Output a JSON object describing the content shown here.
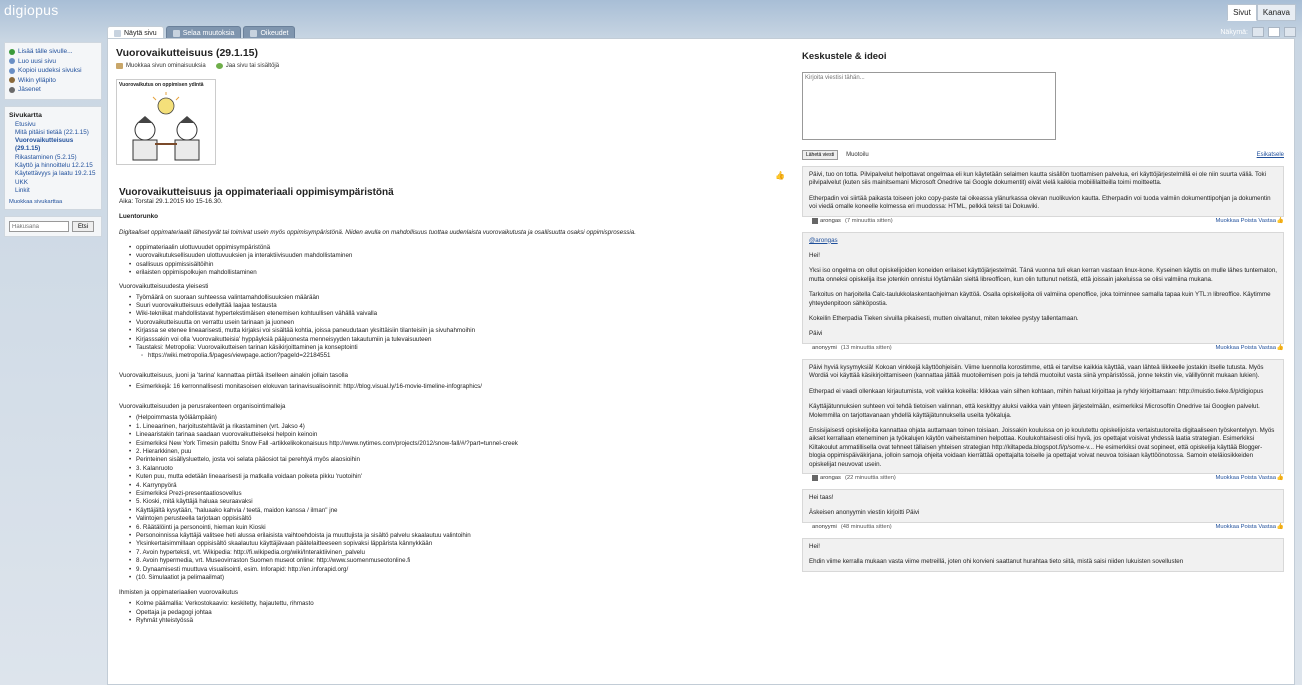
{
  "app": {
    "logo": "digiopus"
  },
  "topright": {
    "pages": "Sivut",
    "channel": "Kanava"
  },
  "view": {
    "label": "Näkymä:"
  },
  "tabs": [
    {
      "label": "Näytä sivu"
    },
    {
      "label": "Selaa muutoksia"
    },
    {
      "label": "Oikeudet"
    }
  ],
  "sidebar": {
    "actions": [
      {
        "label": "Lisää tälle sivulle...",
        "color": "#3a9a3a"
      },
      {
        "label": "Luo uusi sivu",
        "color": "#6a8fc4"
      },
      {
        "label": "Kopioi uudeksi sivuksi",
        "color": "#6a8fc4"
      },
      {
        "label": "Wikin ylläpito",
        "color": "#8b6a3a"
      },
      {
        "label": "Jäsenet",
        "color": "#6a6a6a"
      }
    ],
    "sitemap_title": "Sivukartta",
    "sitemap": [
      {
        "label": "Etusivu",
        "current": false
      },
      {
        "label": "Mitä pitäisi tietää (22.1.15)",
        "current": false
      },
      {
        "label": "Vuorovaikutteisuus (29.1.15)",
        "current": true
      },
      {
        "label": "Rikastaminen (5.2.15)",
        "current": false
      },
      {
        "label": "Käyttö ja hinnoittelu 12.2.15",
        "current": false
      },
      {
        "label": "Käytettävyys ja laatu 19.2.15",
        "current": false
      },
      {
        "label": "UKK",
        "current": false
      },
      {
        "label": "Linkit",
        "current": false
      }
    ],
    "edit_sitemap": "Muokkaa sivukarttaa",
    "search_placeholder": "Hakusana",
    "search_button": "Etsi"
  },
  "page": {
    "title": "Vuorovaikutteisuus (29.1.15)",
    "edit_props": "Muokkaa sivun ominaisuuksia",
    "share": "Jaa sivu tai sisältöjä",
    "image_caption": "Vuorovaikutus on oppimisen ydintä",
    "heading": "Vuorovaikutteisuus ja oppimateriaali oppimisympäristönä",
    "time": "Aika: Torstai 29.1.2015 klo 15-16.30.",
    "subheading": "Luentorunko",
    "intro": "Digitaaliset oppimateriaalit lähestyvät tai toimivat usein myös oppimisympäristönä. Niiden avulla on mahdollisuus tuottaa uudenlaista vuorovaikutusta ja osallisuutta osaksi oppimisprosessia.",
    "list1": [
      "oppimateriaalin ulottuvuudet oppimisympäristönä",
      "vuorovaikutuksellisuuden  ulottuvuuksien ja interaktiivisuuden mahdollistaminen",
      "osallisuus oppimissisältöihin",
      "erilaisten oppimispolkujen mahdollistaminen"
    ],
    "section2": "Vuorovaikutteisuudesta yleisesti",
    "list2": [
      {
        "text": "Työmäärä on suoraan suhteessa valintamahdollisuuksien määrään",
        "sub": false
      },
      {
        "text": "Suuri vuorovaikutteisuus edellyttää laajaa testausta",
        "sub": false
      },
      {
        "text": "Wiki-tekniikat mahdollistavat hypertekstimäisen etenemisen kohtuullisen vähällä vaivalla",
        "sub": false
      },
      {
        "text": "Vuorovaikutteisuutta on verrattu usein tarinaan ja juoneen",
        "sub": false
      },
      {
        "text": "Kirjassa se etenee lineaarisesti, mutta kirjaksi voi sisältää kohtia, joissa paneudutaan yksittäisiin tilanteisiin ja sivuhahmoihin",
        "sub": false
      },
      {
        "text": "Kirjasssakin voi olla 'vuorovaikutteisia' hyppäyksiä pääjuonesta menneisyyden takautumiin ja tulevaisuuteen",
        "sub": false
      },
      {
        "text": "Taustaksi: Metropolia: Vuorovaikutteisen tarinan käsikirjoittaminen ja konseptointi",
        "sub": false
      },
      {
        "text": "https://wiki.metropolia.fi/pages/viewpage.action?pageId=22184551",
        "sub": true
      }
    ],
    "para3": "Vuorovaikutteisuus, juoni ja 'tarina' kannattaa piirtää itselleen ainakin jollain tasolla",
    "list3": [
      "Esimerkkejä: 16 kerronnallisesti monitasoisen elokuvan tarinavisualisoinnit: http://blog.visual.ly/16-movie-timeline-infographics/"
    ],
    "section4": "Vuorovaikutteisuuden ja perusrakenteen organisointimalleja",
    "list4": [
      "(Helpoimmasta työläämpään)",
      "1. Lineaarinen, harjoitustehtävät ja rikastaminen (vrt. Jakso 4)",
      "Lineaaristakin tarinaa saadaan vuorovaikutteiseksi helpoin keinoin",
      "Esimerkiksi New York Timesin palkittu Snow Fall -artikkelikokonaisuus http://www.nytimes.com/projects/2012/snow-fall/#/?part=tunnel-creek",
      "2. Hierarkkinen, puu",
      "Perinteinen sisällysluettelo, josta voi selata pääosiot tai perehtyä myös alaosioihin",
      "3. Kalanruoto",
      "Kuten puu, mutta edetään lineaarisesti ja matkalla voidaan poiketa pikku 'ruotoihin'",
      "4. Karrynpyörä",
      "Esimerkiksi Prezi-presentaatiosovellus",
      "5. Kioski, mitä käyttäjä haluaa seuraavaksi",
      "Käyttäjältä kysytään, \"haluaako kahvia / teetä, maidon kanssa / ilman\" jne",
      "Valintojen perusteella tarjotaan oppisisältö",
      "6. Räätälöinti ja personointi, hieman kuin Kioski",
      "Personoinnissa käyttäjä valitsee heti alussa erilaisista vaihtoehdoista ja muuttujista ja sisältö palvelu skaalautuu valintoihin",
      "Yksinkertaisimmillaan oppisisältö skaalautuu käyttäjävaan päätelaitteeseen sopivaksi läppärista kännykkään",
      "7. Avoin hyperteksti, vrt. Wikipedia: http://fi.wikipedia.org/wiki/Interaktiivinen_palvelu",
      "8. Avoin hypermedia, vrt. Museovirraston Suomen museot online: http://www.suomenmuseotonline.fi",
      "9. Dynaamisesti muuttuva visualisointi, esim. Inforapid: http://en.inforapid.org/",
      "(10. Simulaatiot ja pelimaailmat)"
    ],
    "section5": "Ihmisten ja oppimateriaalien vuorovaikutus",
    "list5": [
      "Kolme päämallia: Verkostokaavio: keskitetty, hajautettu, rihmasto",
      "Opettaja ja pedagogi johtaa",
      "Ryhmät yhteistyössä"
    ]
  },
  "chat": {
    "title": "Keskustele & ideoi",
    "placeholder": "Kirjoita viestisi tähän...",
    "send": "Lähetä viesti",
    "format": "Muotoilu",
    "preview": "Esikatsele",
    "actions": "Muokkaa Poista Vastaa",
    "messages": [
      {
        "paras": [
          "Päivi, tuo on totta. Pilvipalvelut helpottavat ongelmaa eli kun käytetään selaimen kautta sisällön tuottamisen palvelua, eri käyttöjärjestelmillä ei ole niin suurta väliä. Toki pilvipalvelut (kuten siis mainitsemani Microsoft Onedrive tai Google dokumentit) eivät vielä kaikkia mobiililaitteilla toimi moitteetta.",
          "Etherpadin voi siirtää paikasta toiseen joko copy-paste tai oikeassa ylänurkassa olevan nuolikuvion kautta. Etherpadin voi tuoda valmiin dokumenttipohjan ja dokumentin voi viedä omalle koneelle kolmessa eri muodossa: HTML, pelkkä teksti tai Dokuwiki."
        ],
        "author": "arongas",
        "time": "(7 minuuttia sitten)",
        "avatar": true
      },
      {
        "paras": [
          "@arongas",
          "Hei!",
          "Yksi iso ongelma on ollut opiskelijoiden koneiden erilaiset käyttöjärjestelmät. Tänä vuonna tuli ekan kerran vastaan linux-kone. Kyseinen käyttis on mulle lähes tuntematon, mutta onneksi opiskelija itse jotenkin onnistui löytämään sieltä libreofficen, kun olin tuttunut netistä, että joissain jakeluissa se olisi valmiina mukana.",
          "Tarkoitus on harjoitella Calc-taulukkolaskentaohjelman käyttöä. Osalla opiskelijoita oli valmiina openoffice, joka toiminnee samalla tapaa kuin YTL:n libreoffice. Käytimme yhteydenpitoon sähköpostia.",
          "Kokeilin Etherpadia Tieken sivuilla pikaisesti, mutten oivaltanut, miten tekelee pystyy tallentamaan.",
          "Päivi"
        ],
        "author": "anonyymi",
        "time": "(13 minuuttia sitten)",
        "avatar": false
      },
      {
        "paras": [
          "Päivi hyviä kysymyksiä! Kokoan vinkkejä käyttöohjeisiin. Viime luennolla korostimme, että ei tarvitse kaikkia käyttää, vaan lähteä liikkeelle jostakin itselle tutusta. Myös Wordiä voi käyttää käsikirjoittamiseen (kannattaa jättää muotoilemisen pois ja tehdä muotoilut vasta siinä ympäristössä, jonne tekstin vie, välillyönnit mukaan lukien).",
          "Etherpad ei vaadi ollenkaan kirjautumista, voit vaikka kokeilla: klikkaa vain silhen kohtaan, mihin haluat kirjoittaa ja ryhdy kirjoittamaan: http://muistio.tieke.fi/p/digiopus",
          "Käyttäjätunnuksien suhteen voi tehdä tietoisen valinnan, että keskittyy aluksi vaikka vain yhteen järjestelmään, esimerkiksi Microsoftin Onedrive tai Googlen palvelut. Molemmilla on tarjottavanaan yhdellä käyttäjätunnuksella useita työkaluja.",
          "Ensisijaisesti opiskelijoita kannattaa ohjata auttamaan toinen toisiaan. Joissakin kouluissa on jo koulutettu opiskelijoista vertaistuutoreita digitaaliseen työskentelyyn. Myös aikset kerrallaan eteneminen ja työkalujen käytön vaiheistaminen helpottaa. Koulukohtaisesti olisi hyvä, jos opettajat voisivat yhdessä laatia strategian. Esimerkiksi Kiltakoulut ammatillisella ovat tehneet tällaisen yhteisen strategian http://kiltapeda.blogspot.fi/p/some-v... He esimerkiksi ovat sopineet, että opiskelija käyttää Blogger-blogia oppimispäiväkirjana, jolloin samoja ohjeita voidaan kierrättää opettajalta toiselle ja opettajat voivat neuvoa toisiaan käyttöönotossa. Samoin eteläiosikkeiden opiskelijat neuvovat usein."
        ],
        "author": "arongas",
        "time": "(22 minuuttia sitten)",
        "avatar": true
      },
      {
        "paras": [
          "Hei taas!",
          "Äskeisen anonyymin viestin kirjoitti Päivi"
        ],
        "author": "anonyymi",
        "time": "(48 minuuttia sitten)",
        "avatar": false
      },
      {
        "paras": [
          "Hei!",
          "Ehdin viime kerralla mukaan vasta viime metreillä, joten ohi korvieni saattanut hurahtaa tieto siitä, mistä saisi niiden lukuisten sovellusten"
        ],
        "author": "",
        "time": "",
        "avatar": false
      }
    ]
  }
}
